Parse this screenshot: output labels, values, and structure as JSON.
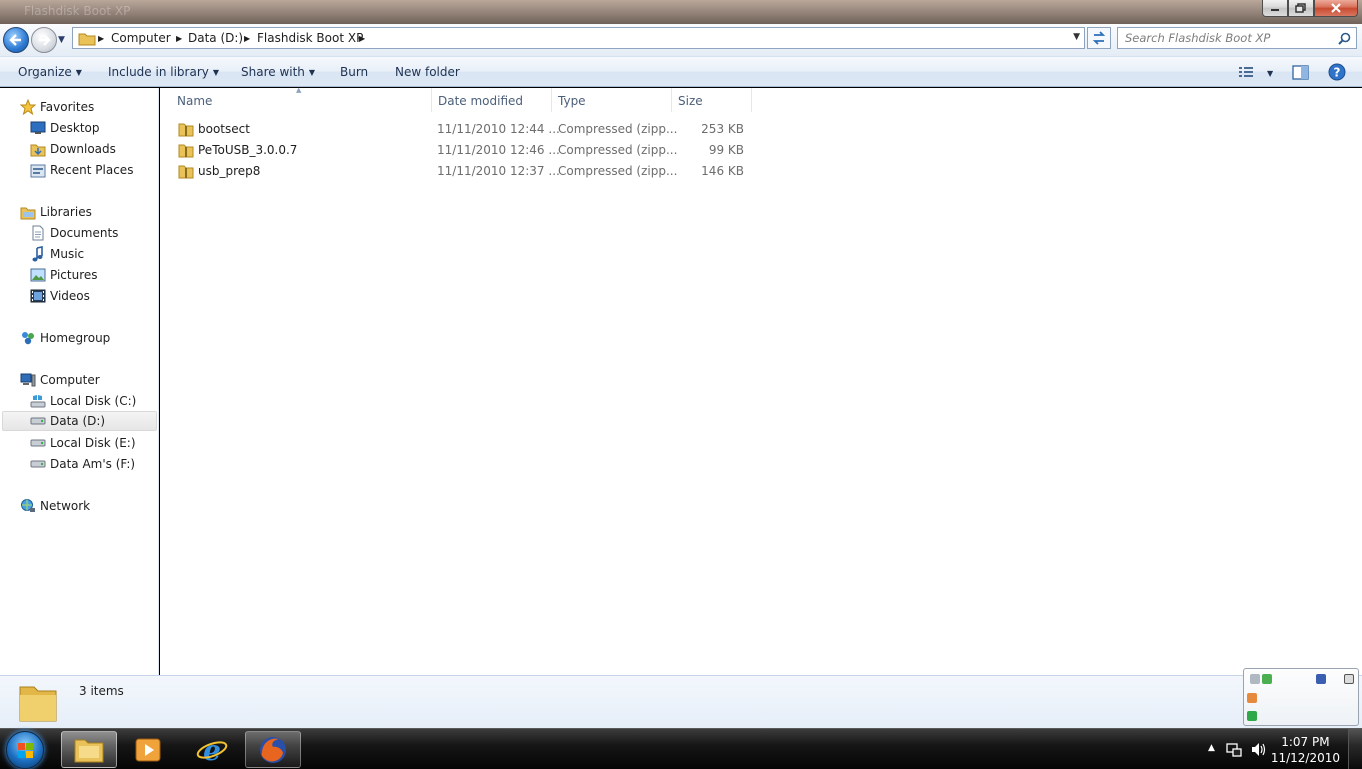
{
  "window": {
    "ghost_title": "Flashdisk Boot XP"
  },
  "breadcrumb": [
    "Computer",
    "Data (D:)",
    "Flashdisk Boot XP"
  ],
  "search": {
    "placeholder": "Search Flashdisk Boot XP"
  },
  "toolbar": {
    "organize": "Organize",
    "include": "Include in library",
    "share": "Share with",
    "burn": "Burn",
    "new_folder": "New folder"
  },
  "nav": {
    "favorites": "Favorites",
    "desktop": "Desktop",
    "downloads": "Downloads",
    "recent": "Recent Places",
    "libraries": "Libraries",
    "documents": "Documents",
    "music": "Music",
    "pictures": "Pictures",
    "videos": "Videos",
    "homegroup": "Homegroup",
    "computer": "Computer",
    "disk_c": "Local Disk (C:)",
    "disk_d": "Data (D:)",
    "disk_e": "Local Disk (E:)",
    "disk_f": "Data Am's (F:)",
    "network": "Network"
  },
  "columns": {
    "name": "Name",
    "date": "Date modified",
    "type": "Type",
    "size": "Size"
  },
  "files": [
    {
      "name": "bootsect",
      "date": "11/11/2010 12:44 ...",
      "type": "Compressed (zipp...",
      "size": "253 KB"
    },
    {
      "name": "PeToUSB_3.0.0.7",
      "date": "11/11/2010 12:46 ...",
      "type": "Compressed (zipp...",
      "size": "99 KB"
    },
    {
      "name": "usb_prep8",
      "date": "11/11/2010 12:37 ...",
      "type": "Compressed (zipp...",
      "size": "146 KB"
    }
  ],
  "details": {
    "count": "3 items"
  },
  "clock": {
    "time": "1:07 PM",
    "date": "11/12/2010"
  },
  "colors": {
    "accent": "#2d7ad3",
    "folder": "#e9c25a",
    "selection": "#e6e6e6"
  }
}
